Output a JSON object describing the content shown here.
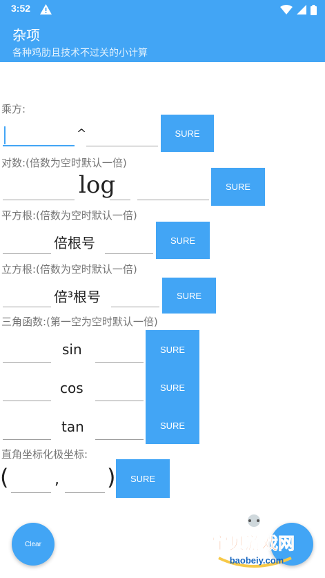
{
  "status_bar": {
    "time": "3:52"
  },
  "app_bar": {
    "title": "杂项",
    "subtitle": "各种鸡肋且技术不过关的小计算"
  },
  "sections": {
    "power_label": "乘方:",
    "power_op": "^",
    "log_label": "对数:(倍数为空时默认一倍)",
    "log_op": "log",
    "sqrt_label": "平方根:(倍数为空时默认一倍)",
    "sqrt_op": "倍根号",
    "cbrt_label": "立方根:(倍数为空时默认一倍)",
    "cbrt_op": "倍³根号",
    "trig_label": "三角函数:(第一空为空时默认一倍)",
    "sin_op": "sin",
    "cos_op": "cos",
    "tan_op": "tan",
    "polar_label": "直角坐标化极坐标:",
    "polar_open": "(",
    "polar_comma": ",",
    "polar_close": ")"
  },
  "buttons": {
    "sure": "SURE",
    "clear": "Clear"
  },
  "colors": {
    "accent": "#42a5f5"
  },
  "watermark": {
    "name": "宝贝游戏网",
    "url": "baobeiy.com"
  }
}
